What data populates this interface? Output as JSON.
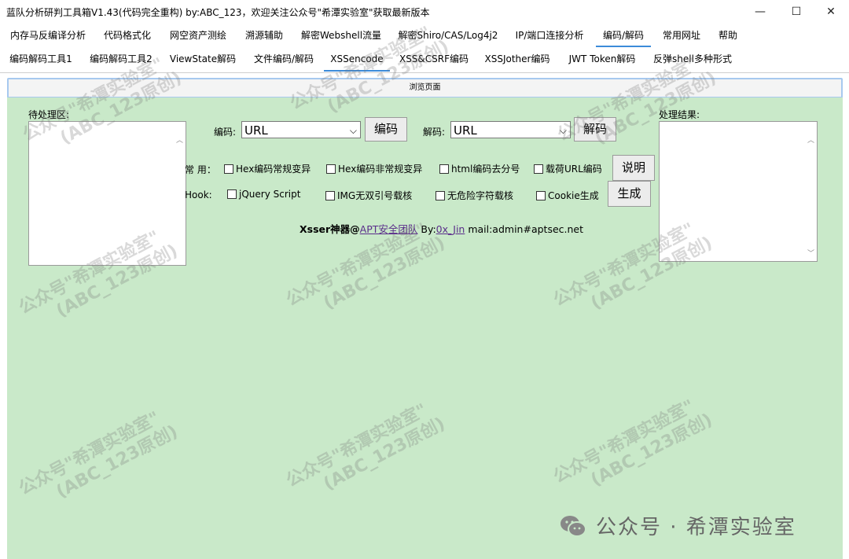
{
  "window": {
    "title": "蓝队分析研判工具箱V1.43(代码完全重构) by:ABC_123，欢迎关注公众号\"希潭实验室\"获取最新版本",
    "minimize_glyph": "—",
    "maximize_glyph": "☐",
    "close_glyph": "✕"
  },
  "menu": {
    "tabs": [
      "内存马反编译分析",
      "代码格式化",
      "网空资产测绘",
      "溯源辅助",
      "解密Webshell流量",
      "解密Shiro/CAS/Log4j2",
      "IP/端口连接分析",
      "编码/解码",
      "常用网址",
      "帮助"
    ],
    "active": "编码/解码"
  },
  "subtabs": {
    "tabs": [
      "编码解码工具1",
      "编码解码工具2",
      "ViewState解码",
      "文件编码/解码",
      "XSSencode",
      "XSS&CSRF编码",
      "XSSJother编码",
      "JWT Token解码",
      "反弹shell多种形式"
    ],
    "active": "XSSencode"
  },
  "browse_button": "浏览页面",
  "input_area": {
    "label": "待处理区:"
  },
  "output_area": {
    "label": "处理结果:"
  },
  "encode": {
    "label": "编码:",
    "selected": "URL",
    "button": "编码"
  },
  "decode": {
    "label": "解码:",
    "selected": "URL",
    "button": "解码"
  },
  "common": {
    "label": "常 用：",
    "options": [
      "Hex编码常规变异",
      "Hex编码非常规变异",
      "html编码去分号",
      "载荷URL编码"
    ],
    "button": "说明"
  },
  "hook": {
    "label": "Hook:",
    "options": [
      "jQuery Script",
      "IMG无双引号载核",
      "无危险字符载核",
      "Cookie生成"
    ],
    "button": "生成"
  },
  "credit": {
    "prefix": "Xsser神器@",
    "team": "APT安全团队",
    "by": " By:",
    "author": "0x_Jin",
    "mail": " mail:admin#aptsec.net"
  },
  "watermark": {
    "line1": "公众号\"希潭实验室\"",
    "line2": "(ABC_123原创)"
  },
  "brand": {
    "text": "公众号 · 希潭实验室",
    "icon": "wechat-icon"
  },
  "colors": {
    "panel_bg": "#c9e9c9",
    "active_tab": "#3c8bd9"
  }
}
